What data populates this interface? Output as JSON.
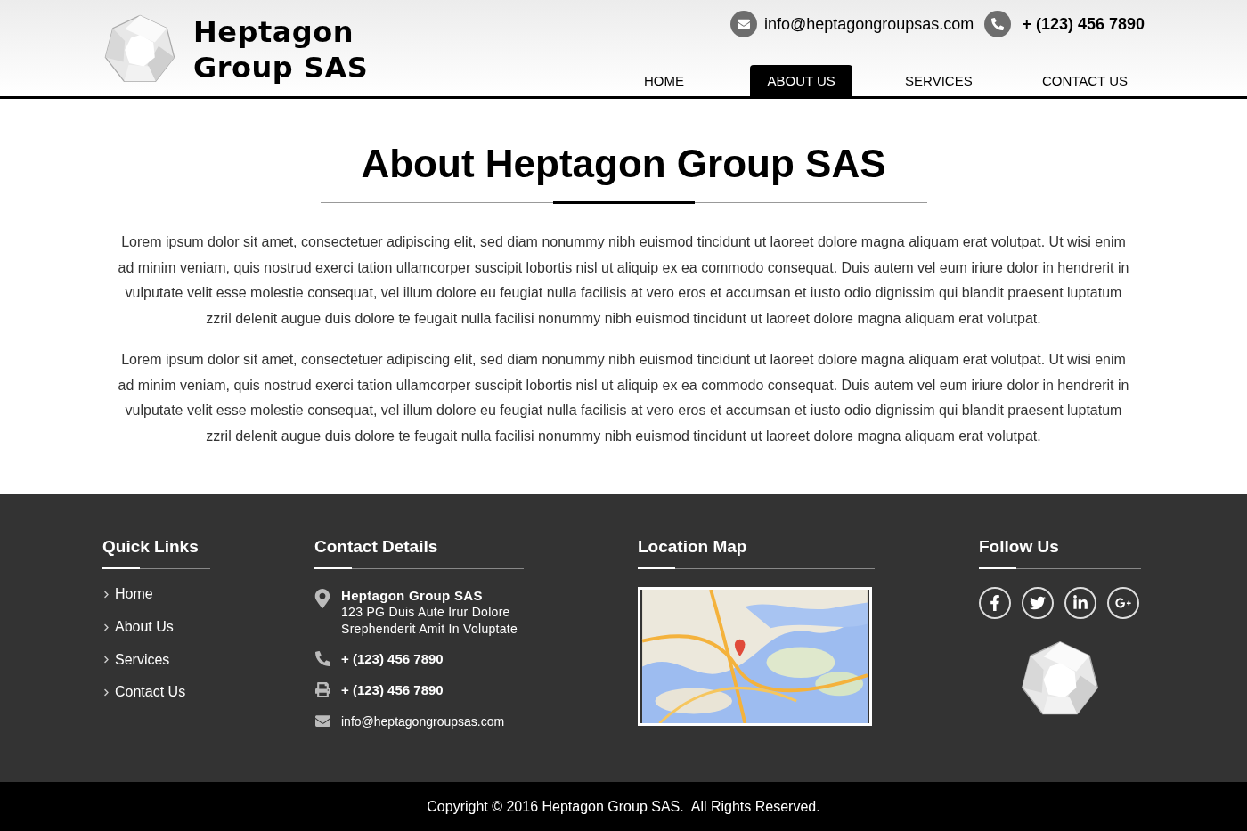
{
  "header": {
    "logo": {
      "line1": "Heptagon",
      "line2": "Group SAS"
    },
    "email": "info@heptagongroupsas.com",
    "phone": "+ (123) 456 7890",
    "nav": [
      {
        "label": "HOME",
        "selected": false
      },
      {
        "label": "ABOUT US",
        "selected": true
      },
      {
        "label": "SERVICES",
        "selected": false
      },
      {
        "label": "CONTACT US",
        "selected": false
      }
    ]
  },
  "about": {
    "title": "About Heptagon Group SAS",
    "paragraphs": [
      "Lorem ipsum dolor sit amet, consectetuer adipiscing elit, sed diam nonummy nibh euismod tincidunt ut laoreet dolore magna aliquam erat volutpat. Ut wisi enim ad minim veniam, quis nostrud exerci tation ullamcorper suscipit lobortis nisl ut aliquip ex ea commodo consequat. Duis autem vel eum iriure dolor in hendrerit in vulputate velit esse molestie consequat, vel illum dolore eu feugiat nulla facilisis at vero eros et accumsan et iusto odio dignissim qui blandit praesent luptatum zzril delenit augue duis dolore te feugait nulla facilisi nonummy nibh euismod tincidunt ut laoreet dolore magna aliquam erat volutpat.",
      "Lorem ipsum dolor sit amet, consectetuer adipiscing elit, sed diam nonummy nibh euismod tincidunt ut laoreet dolore magna aliquam erat volutpat. Ut wisi enim ad minim veniam, quis nostrud exerci tation ullamcorper suscipit lobortis nisl ut aliquip ex ea commodo consequat. Duis autem vel eum iriure dolor in hendrerit in vulputate velit esse molestie consequat, vel illum dolore eu feugiat nulla facilisis at vero eros et accumsan et iusto odio dignissim qui blandit praesent luptatum zzril delenit augue duis dolore te feugait nulla facilisi nonummy nibh euismod tincidunt ut laoreet dolore magna aliquam erat volutpat."
    ]
  },
  "footer": {
    "quick_links": {
      "title": "Quick Links",
      "items": [
        "Home",
        "About Us",
        "Services",
        "Contact Us"
      ]
    },
    "contact_details": {
      "title": "Contact Details",
      "company": "Heptagon Group SAS",
      "address_lines": [
        "123 PG Duis Aute Irur Dolore",
        "Srephenderit Amit In Voluptate"
      ],
      "items": [
        {
          "kind": "phone",
          "text": "+ (123) 456 7890"
        },
        {
          "kind": "fax",
          "text": "+ (123) 456 7890"
        },
        {
          "kind": "email",
          "text": "info@heptagongroupsas.com"
        }
      ]
    },
    "location_map": {
      "title": "Location Map"
    },
    "follow_us": {
      "title": "Follow Us",
      "networks": [
        {
          "kind": "facebook"
        },
        {
          "kind": "twitter"
        },
        {
          "kind": "linkedin"
        },
        {
          "kind": "googleplus"
        }
      ]
    }
  },
  "copyright": "Copyright © 2016 Heptagon Group SAS.  All Rights Reserved."
}
